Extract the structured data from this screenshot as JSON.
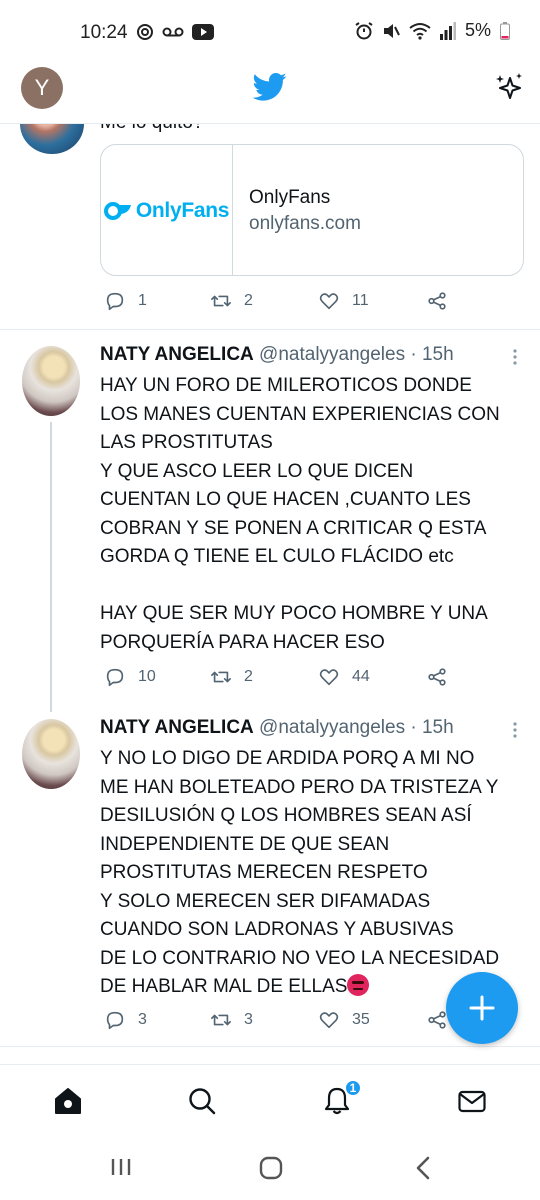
{
  "status_bar": {
    "time": "10:24",
    "battery": "5%"
  },
  "topbar": {
    "account_initial": "Y"
  },
  "partial_tweet": {
    "text_fragment": "Me lo quito?",
    "card": {
      "logo_text": "OnlyFans",
      "title": "OnlyFans",
      "domain": "onlyfans.com"
    },
    "replies": "1",
    "retweets": "2",
    "likes": "11"
  },
  "tweets": [
    {
      "name": "NATY ANGELICA",
      "handle": "@natalyyangeles · 15h",
      "text": "HAY UN FORO DE MILEROTICOS DONDE\nLOS MANES CUENTAN EXPERIENCIAS CON\nLAS PROSTITUTAS\nY QUE ASCO LEER LO QUE DICEN\nCUENTAN LO QUE HACEN ,CUANTO LES\nCOBRAN Y SE PONEN A CRITICAR Q ESTA\nGORDA Q TIENE EL CULO FLÁCIDO etc\n\nHAY QUE SER MUY POCO HOMBRE Y UNA\nPORQUERÍA PARA HACER ESO",
      "replies": "10",
      "retweets": "2",
      "likes": "44"
    },
    {
      "name": "NATY ANGELICA",
      "handle": "@natalyyangeles · 15h",
      "text": "Y NO LO DIGO DE ARDIDA PORQ A MI NO\nME HAN BOLETEADO PERO DA TRISTEZA Y\nDESILUSIÓN Q LOS HOMBRES SEAN ASÍ\nINDEPENDIENTE DE QUE SEAN\nPROSTITUTAS MERECEN RESPETO\nY SOLO MERECEN SER DIFAMADAS\nCUANDO SON LADRONAS Y ABUSIVAS\nDE LO CONTRARIO NO VEO LA NECESIDAD\nDE HABLAR MAL DE ELLAS",
      "emoji": "angry-face-icon",
      "replies": "3",
      "retweets": "3",
      "likes": "35"
    }
  ],
  "tabbar": {
    "notification_count": "1"
  },
  "colors": {
    "twitter_blue": "#1d9bf0",
    "onlyfans_blue": "#00aff0",
    "secondary_text": "#536471"
  }
}
